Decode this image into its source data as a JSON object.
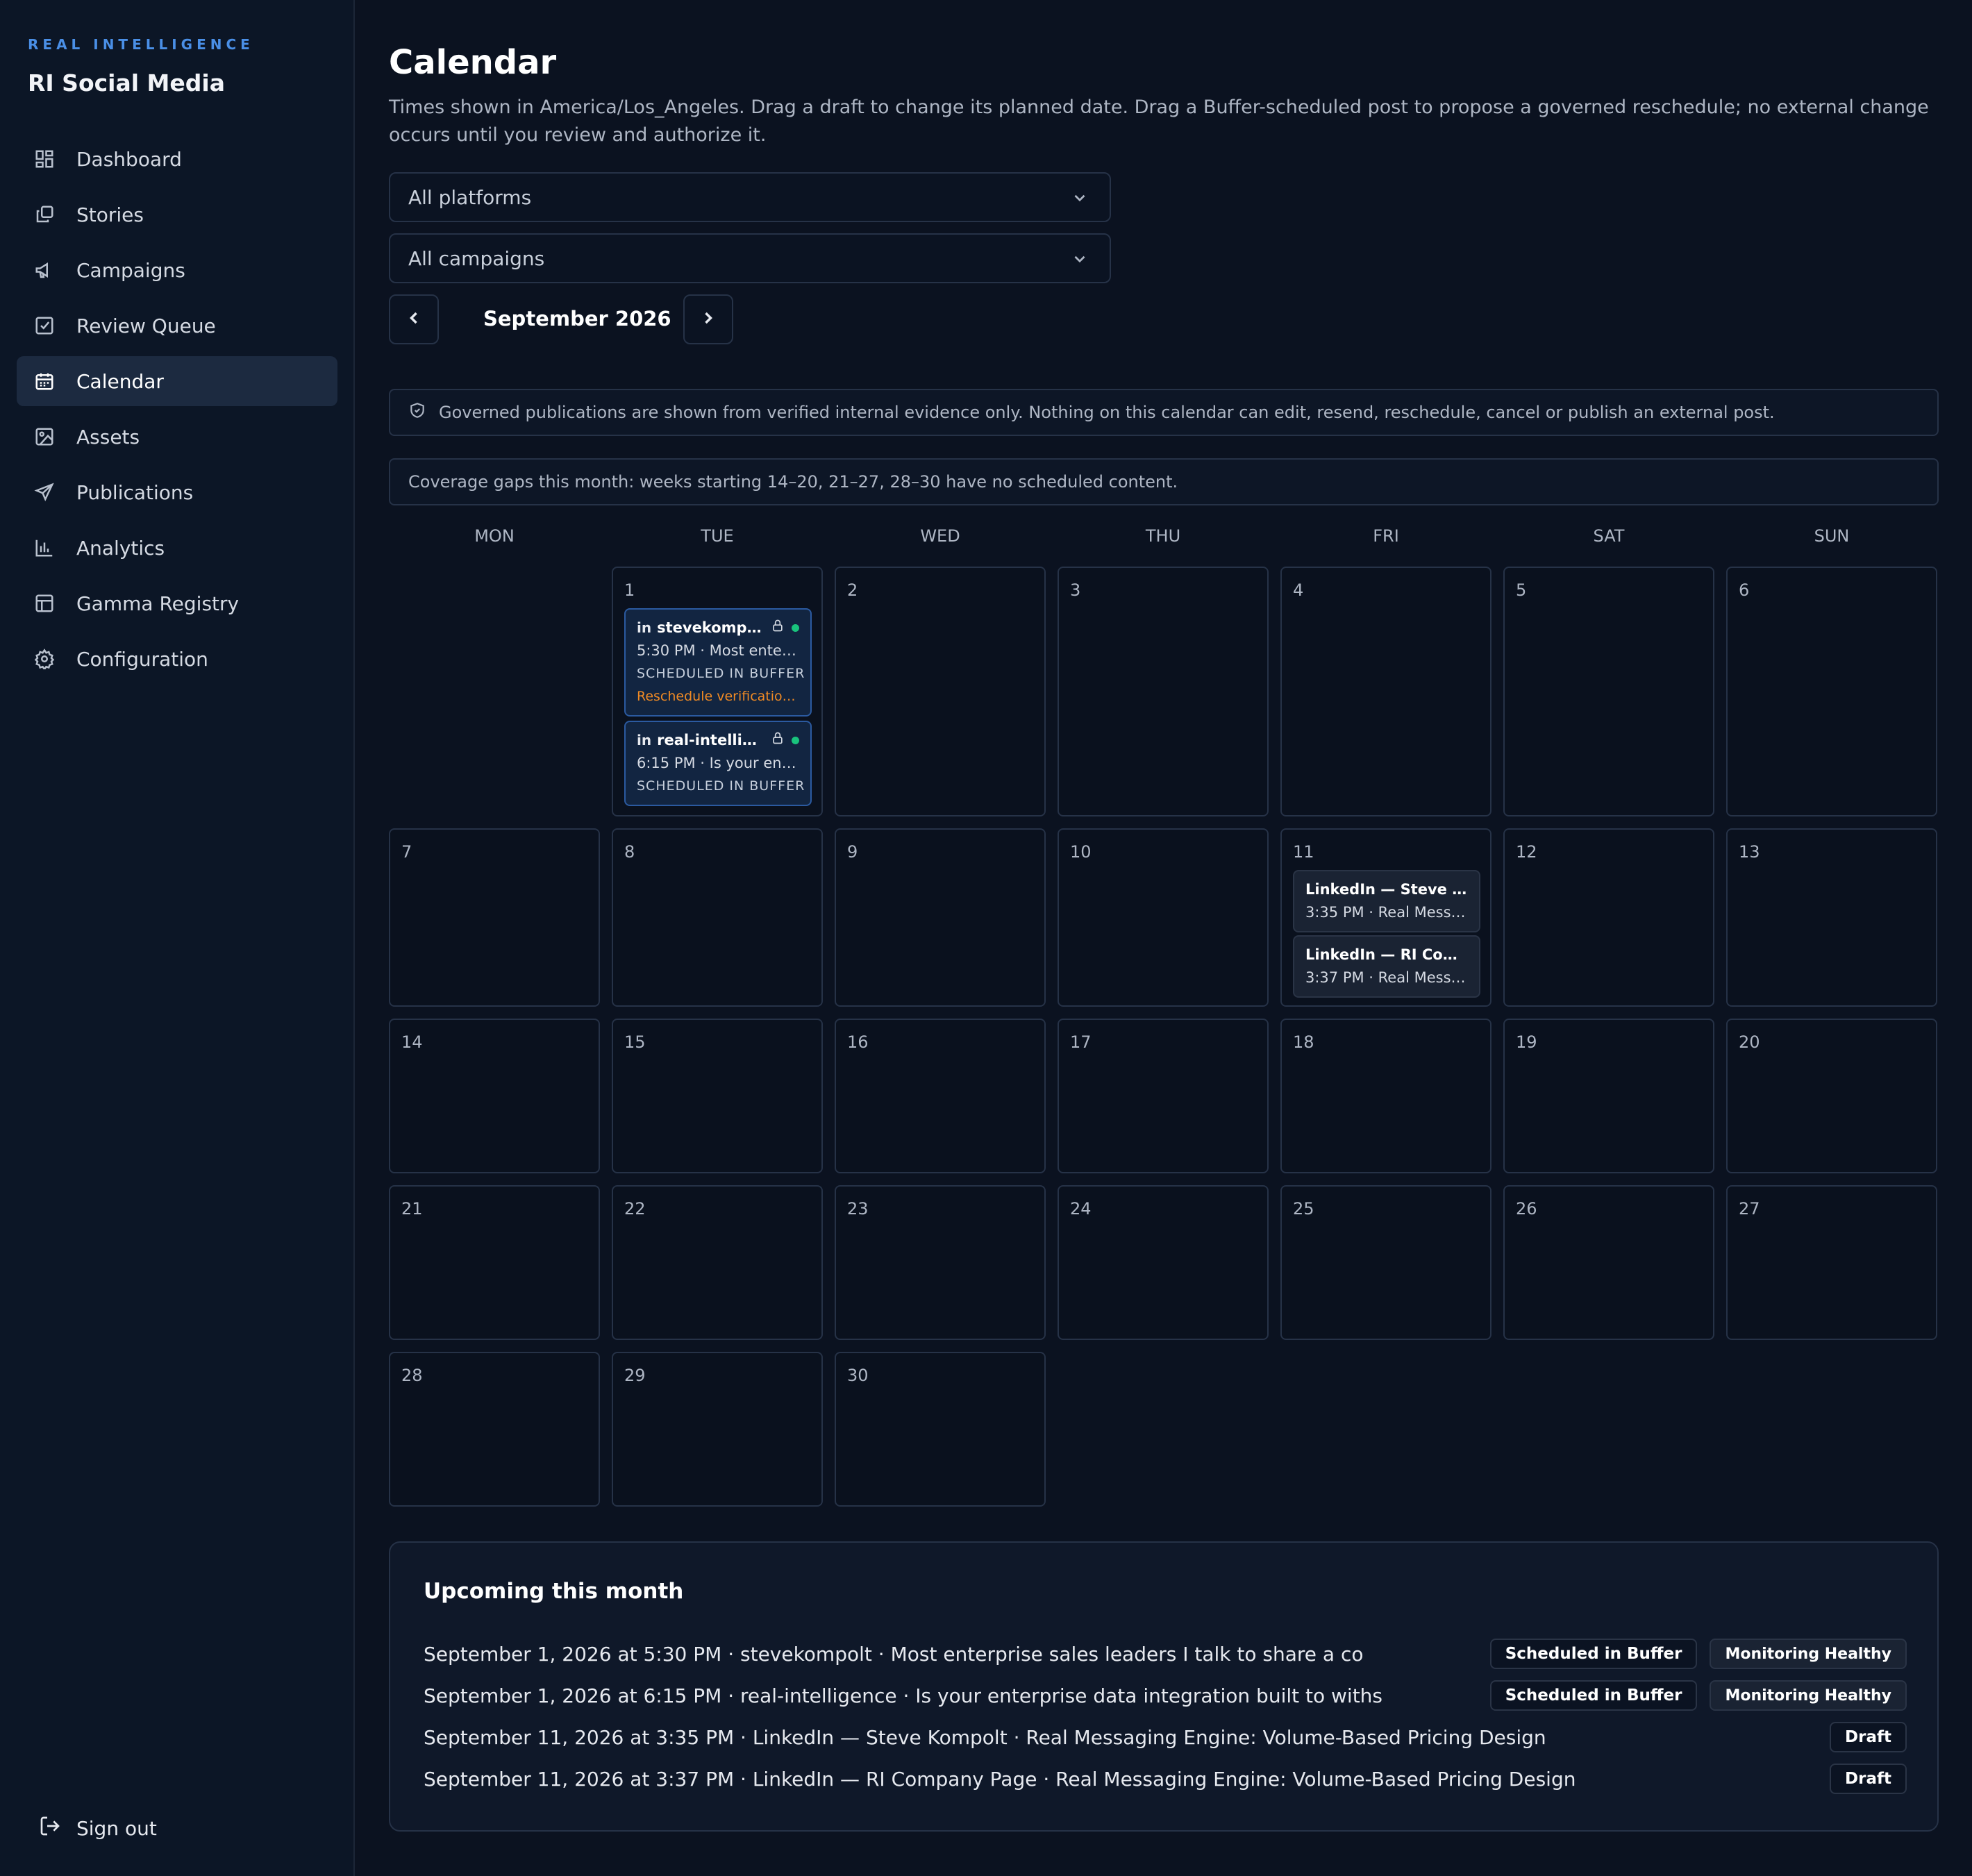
{
  "app": {
    "kicker": "REAL INTELLIGENCE",
    "title": "RI Social Media"
  },
  "sidebar": {
    "items": [
      {
        "label": "Dashboard",
        "icon": "dashboard-icon"
      },
      {
        "label": "Stories",
        "icon": "stories-icon"
      },
      {
        "label": "Campaigns",
        "icon": "megaphone-icon"
      },
      {
        "label": "Review Queue",
        "icon": "checkbox-icon"
      },
      {
        "label": "Calendar",
        "icon": "calendar-icon",
        "active": true
      },
      {
        "label": "Assets",
        "icon": "image-icon"
      },
      {
        "label": "Publications",
        "icon": "send-icon"
      },
      {
        "label": "Analytics",
        "icon": "bar-chart-icon"
      },
      {
        "label": "Gamma Registry",
        "icon": "table-icon"
      },
      {
        "label": "Configuration",
        "icon": "gear-icon"
      }
    ],
    "signout": "Sign out"
  },
  "page": {
    "title": "Calendar",
    "description": "Times shown in America/Los_Angeles. Drag a draft to change its planned date. Drag a Buffer-scheduled post to propose a governed reschedule; no external change occurs until you review and authorize it."
  },
  "filters": {
    "platform": "All platforms",
    "campaign": "All campaigns"
  },
  "month_nav": {
    "label": "September 2026"
  },
  "notices": {
    "governed": "Governed publications are shown from verified internal evidence only. Nothing on this calendar can edit, resend, reschedule, cancel or publish an external post.",
    "coverage": "Coverage gaps this month: weeks starting 14–20, 21–27, 28–30 have no scheduled content."
  },
  "weekdays": [
    "MON",
    "TUE",
    "WED",
    "THU",
    "FRI",
    "SAT",
    "SUN"
  ],
  "days": [
    "1",
    "2",
    "3",
    "4",
    "5",
    "6",
    "7",
    "8",
    "9",
    "10",
    "11",
    "12",
    "13",
    "14",
    "15",
    "16",
    "17",
    "18",
    "19",
    "20",
    "21",
    "22",
    "23",
    "24",
    "25",
    "26",
    "27",
    "28",
    "29",
    "30"
  ],
  "events": {
    "d1_a": {
      "name": "stevekompolt",
      "line": "5:30 PM · Most enterprise sales leaders",
      "status": "SCHEDULED IN BUFFER",
      "warn": "Reschedule verification pending"
    },
    "d1_b": {
      "name": "real-intelligence",
      "line": "6:15 PM · Is your enterprise data",
      "status": "SCHEDULED IN BUFFER"
    },
    "d11_a": {
      "name": "LinkedIn — Steve Kompolt",
      "line": "3:35 PM · Real Messaging Engine"
    },
    "d11_b": {
      "name": "LinkedIn — RI Company Page",
      "line": "3:37 PM · Real Messaging Engine"
    }
  },
  "upcoming": {
    "title": "Upcoming this month",
    "rows": [
      {
        "text": "September 1, 2026 at 5:30 PM · stevekompolt · Most enterprise sales leaders I talk to share a co",
        "badge1": "Scheduled in Buffer",
        "badge2": "Monitoring Healthy"
      },
      {
        "text": "September 1, 2026 at 6:15 PM · real-intelligence · Is your enterprise data integration built to withs",
        "badge1": "Scheduled in Buffer",
        "badge2": "Monitoring Healthy"
      },
      {
        "text": "September 11, 2026 at 3:35 PM · LinkedIn — Steve Kompolt · Real Messaging Engine: Volume-Based Pricing Design",
        "badge1": "Draft"
      },
      {
        "text": "September 11, 2026 at 3:37 PM · LinkedIn — RI Company Page · Real Messaging Engine: Volume-Based Pricing Design",
        "badge1": "Draft"
      }
    ]
  },
  "colors": {
    "accent": "#4a8fe6",
    "background": "#0b1220",
    "status_ok": "#19c37d",
    "warning": "#f08a24"
  }
}
